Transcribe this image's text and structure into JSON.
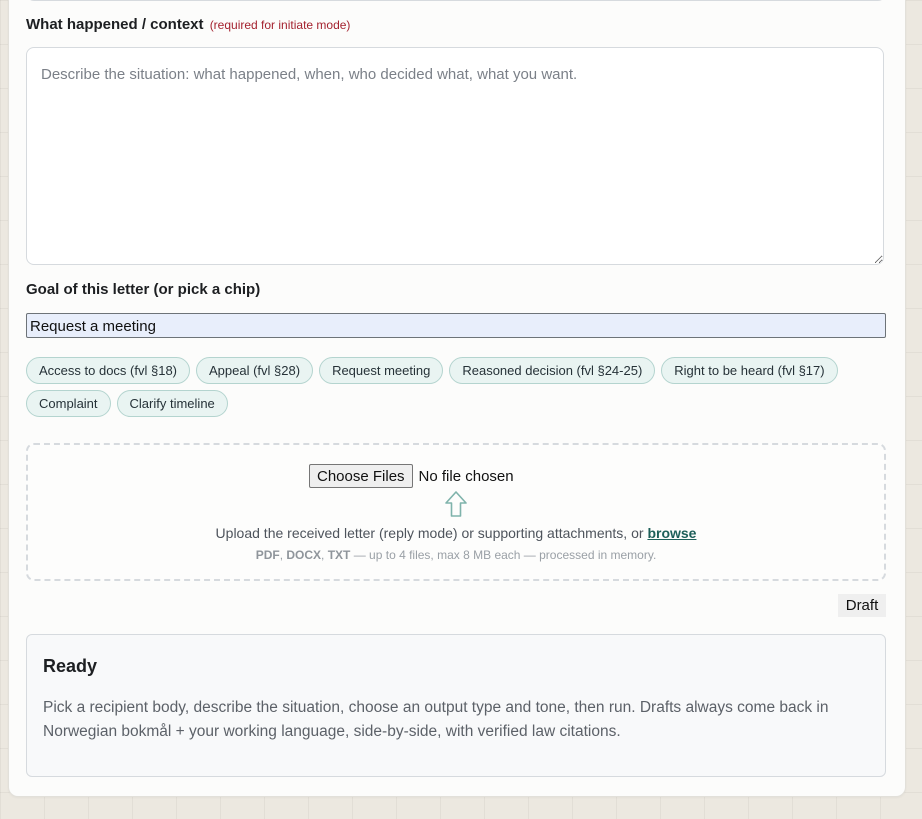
{
  "context": {
    "label": "What happened / context",
    "required_note": "(required for initiate mode)",
    "placeholder": "Describe the situation: what happened, when, who decided what, what you want.",
    "value": ""
  },
  "goal": {
    "label": "Goal of this letter (or pick a chip)",
    "value": "Request a meeting",
    "chips": [
      "Access to docs (fvl §18)",
      "Appeal (fvl §28)",
      "Request meeting",
      "Reasoned decision (fvl §24-25)",
      "Right to be heard (fvl §17)",
      "Complaint",
      "Clarify timeline"
    ]
  },
  "upload": {
    "choose_label": "Choose Files",
    "file_status": "No file chosen",
    "arrow_icon": "upload-arrow-icon",
    "text_before": "Upload the received letter (reply mode) or supporting attachments, or",
    "browse_label": "browse",
    "hint": {
      "formats": [
        "PDF",
        "DOCX",
        "TXT"
      ],
      "separator": ", ",
      "rest": " — up to 4 files, max 8 MB each — processed in memory."
    }
  },
  "status_badge": "Draft",
  "result": {
    "heading": "Ready",
    "text": "Pick a recipient body, describe the situation, choose an output type and tone, then run. Drafts always come back in Norwegian bokmål + your working language, side-by-side, with verified law citations."
  },
  "colors": {
    "accent": "#1d5f59",
    "required": "#a4222f",
    "chip_bg": "#e9f4f2",
    "chip_border": "#b4d4cf",
    "input_autofill": "#e8eefb"
  }
}
